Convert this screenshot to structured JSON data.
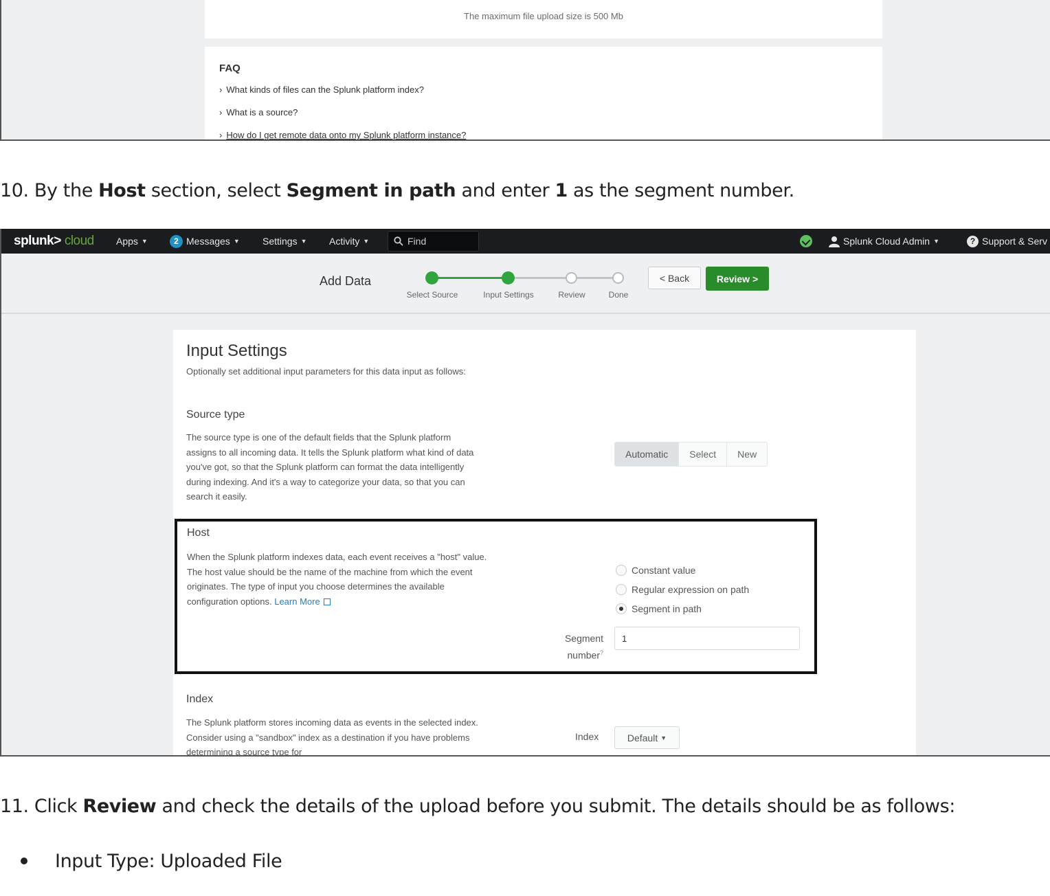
{
  "screenshot1": {
    "upload_note": "The maximum file upload size is 500 Mb",
    "faq_title": "FAQ",
    "faq_items": [
      "What kinds of files can the Splunk platform index?",
      "What is a source?",
      "How do I get remote data onto my Splunk platform instance?"
    ]
  },
  "step10": {
    "prefix": "10. By the ",
    "host": "Host",
    "mid1": " section, select ",
    "segment": "Segment in path",
    "mid2": " and enter ",
    "num": "1",
    "suffix": " as the segment number."
  },
  "topbar": {
    "logo_main": "splunk>",
    "logo_accent": "cloud",
    "apps": "Apps",
    "messages_count": "2",
    "messages": "Messages",
    "settings": "Settings",
    "activity": "Activity",
    "find": "Find",
    "user": "Splunk Cloud Admin",
    "support": "Support & Serv"
  },
  "wizard": {
    "title": "Add Data",
    "steps": [
      "Select Source",
      "Input Settings",
      "Review",
      "Done"
    ],
    "back": "< Back",
    "review": "Review >"
  },
  "panel": {
    "title": "Input Settings",
    "subtitle": "Optionally set additional input parameters for this data input as follows:",
    "source_type_title": "Source type",
    "source_type_desc": "The source type is one of the default fields that the Splunk platform assigns to all incoming data. It tells the Splunk platform what kind of data you've got, so that the Splunk platform can format the data intelligently during indexing. And it's a way to categorize your data, so that you can search it easily.",
    "source_type_options": [
      "Automatic",
      "Select",
      "New"
    ],
    "host_title": "Host",
    "host_desc": "When the Splunk platform indexes data, each event receives a \"host\" value. The host value should be the name of the machine from which the event originates. The type of input you choose determines the available configuration options.",
    "learn_more": "Learn More",
    "host_options": [
      "Constant value",
      "Regular expression on path",
      "Segment in path"
    ],
    "segment_label_1": "Segment",
    "segment_label_2": "number",
    "segment_help": "?",
    "segment_value": "1",
    "index_title": "Index",
    "index_desc": "The Splunk platform stores incoming data as events in the selected index. Consider using a \"sandbox\" index as a destination if you have problems determining a source type for",
    "index_label": "Index",
    "index_value": "Default"
  },
  "step11": {
    "prefix": "11. Click ",
    "review": "Review",
    "suffix": " and check the details of the upload before you submit. The details should be as follows:"
  },
  "bullet1": "Input Type: Uploaded File"
}
